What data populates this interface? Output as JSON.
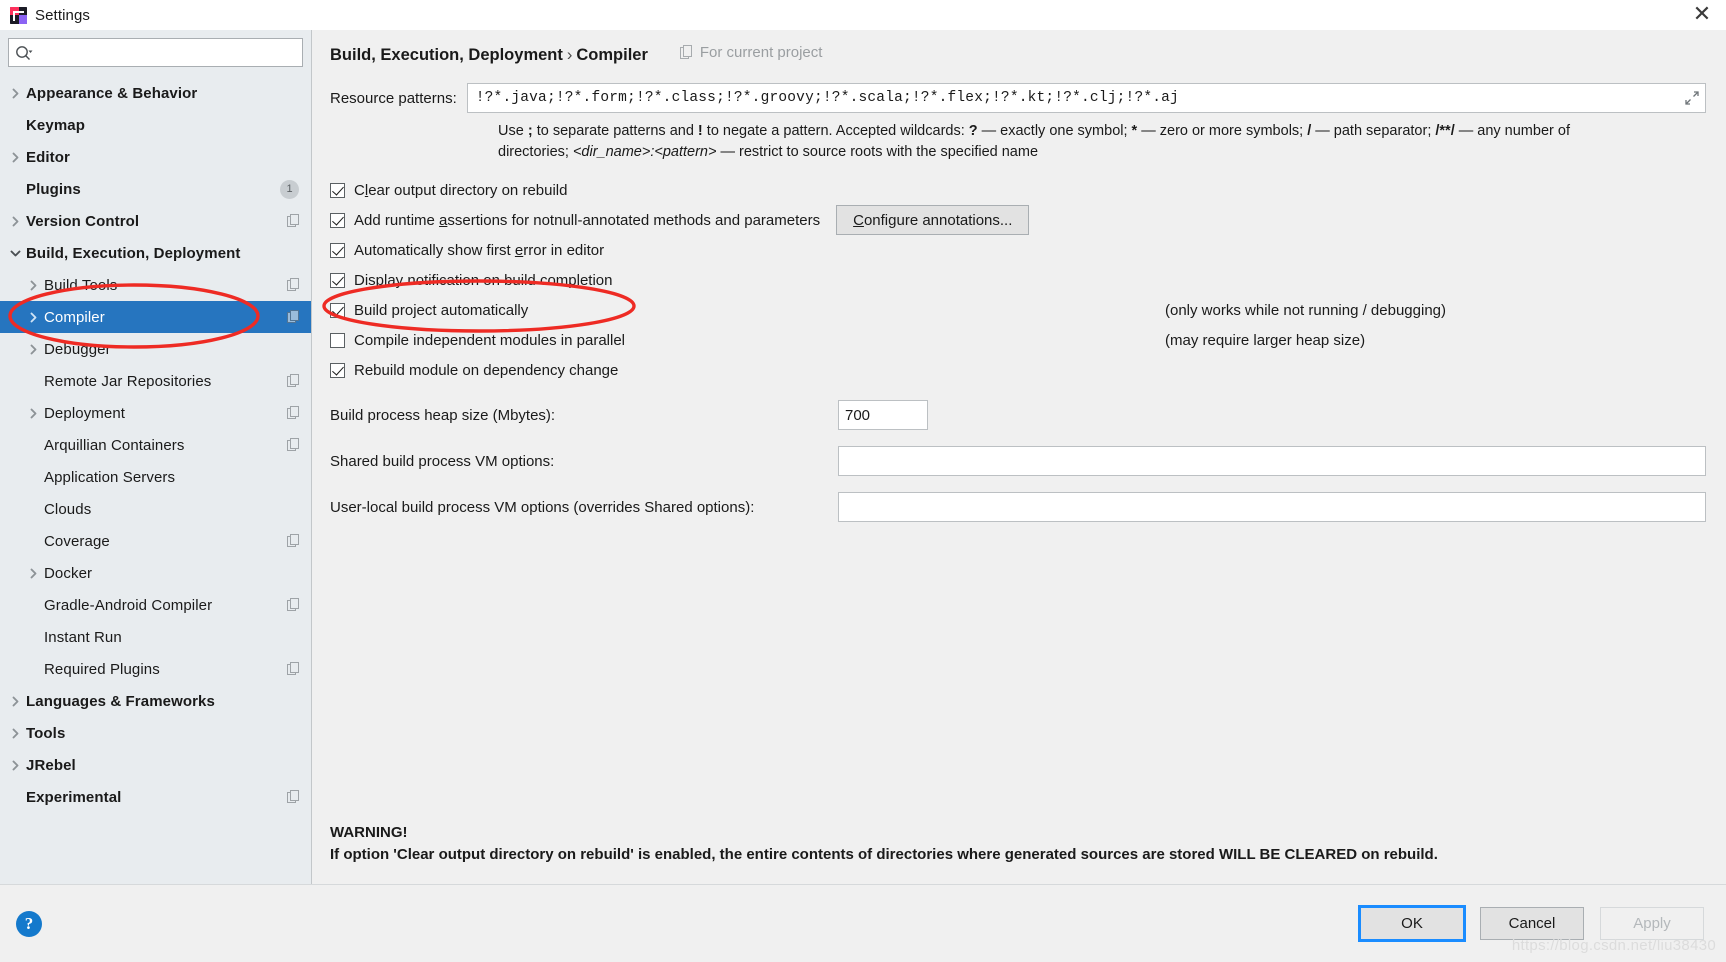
{
  "window": {
    "title": "Settings",
    "logo_icon": "intellij-idea-logo",
    "close_icon": "close-icon"
  },
  "search": {
    "value": "",
    "placeholder": "",
    "icon": "search-icon"
  },
  "sidebar": {
    "items": [
      {
        "label": "Appearance & Behavior",
        "depth": 0,
        "bold": true,
        "chevron": "chevron-right-icon",
        "badge": "",
        "copy": false
      },
      {
        "label": "Keymap",
        "depth": 0,
        "bold": true,
        "chevron": "",
        "badge": "",
        "copy": false
      },
      {
        "label": "Editor",
        "depth": 0,
        "bold": true,
        "chevron": "chevron-right-icon",
        "badge": "",
        "copy": false
      },
      {
        "label": "Plugins",
        "depth": 0,
        "bold": true,
        "chevron": "",
        "badge": "1",
        "copy": false
      },
      {
        "label": "Version Control",
        "depth": 0,
        "bold": true,
        "chevron": "chevron-right-icon",
        "badge": "",
        "copy": true
      },
      {
        "label": "Build, Execution, Deployment",
        "depth": 0,
        "bold": true,
        "chevron": "chevron-down-icon",
        "badge": "",
        "copy": false
      },
      {
        "label": "Build Tools",
        "depth": 1,
        "bold": false,
        "chevron": "chevron-right-icon",
        "badge": "",
        "copy": true
      },
      {
        "label": "Compiler",
        "depth": 1,
        "bold": false,
        "chevron": "chevron-right-icon",
        "badge": "",
        "copy": true,
        "selected": true
      },
      {
        "label": "Debugger",
        "depth": 1,
        "bold": false,
        "chevron": "chevron-right-icon",
        "badge": "",
        "copy": false
      },
      {
        "label": "Remote Jar Repositories",
        "depth": 1,
        "bold": false,
        "chevron": "",
        "badge": "",
        "copy": true
      },
      {
        "label": "Deployment",
        "depth": 1,
        "bold": false,
        "chevron": "chevron-right-icon",
        "badge": "",
        "copy": true
      },
      {
        "label": "Arquillian Containers",
        "depth": 1,
        "bold": false,
        "chevron": "",
        "badge": "",
        "copy": true
      },
      {
        "label": "Application Servers",
        "depth": 1,
        "bold": false,
        "chevron": "",
        "badge": "",
        "copy": false
      },
      {
        "label": "Clouds",
        "depth": 1,
        "bold": false,
        "chevron": "",
        "badge": "",
        "copy": false
      },
      {
        "label": "Coverage",
        "depth": 1,
        "bold": false,
        "chevron": "",
        "badge": "",
        "copy": true
      },
      {
        "label": "Docker",
        "depth": 1,
        "bold": false,
        "chevron": "chevron-right-icon",
        "badge": "",
        "copy": false
      },
      {
        "label": "Gradle-Android Compiler",
        "depth": 1,
        "bold": false,
        "chevron": "",
        "badge": "",
        "copy": true
      },
      {
        "label": "Instant Run",
        "depth": 1,
        "bold": false,
        "chevron": "",
        "badge": "",
        "copy": false
      },
      {
        "label": "Required Plugins",
        "depth": 1,
        "bold": false,
        "chevron": "",
        "badge": "",
        "copy": true
      },
      {
        "label": "Languages & Frameworks",
        "depth": 0,
        "bold": true,
        "chevron": "chevron-right-icon",
        "badge": "",
        "copy": false
      },
      {
        "label": "Tools",
        "depth": 0,
        "bold": true,
        "chevron": "chevron-right-icon",
        "badge": "",
        "copy": false
      },
      {
        "label": "JRebel",
        "depth": 0,
        "bold": true,
        "chevron": "chevron-right-icon",
        "badge": "",
        "copy": false
      },
      {
        "label": "Experimental",
        "depth": 0,
        "bold": true,
        "chevron": "",
        "badge": "",
        "copy": true
      }
    ]
  },
  "main": {
    "breadcrumb_parent": "Build, Execution, Deployment",
    "breadcrumb_sep": "›",
    "breadcrumb_current": "Compiler",
    "for_current_project": "For current project",
    "resource_patterns_label": "Resource patterns:",
    "resource_patterns_value": "!?*.java;!?*.form;!?*.class;!?*.groovy;!?*.scala;!?*.flex;!?*.kt;!?*.clj;!?*.aj",
    "expand_icon": "expand-diagonal-icon",
    "hint_line1_a": "Use ",
    "hint_semicolon": ";",
    "hint_line1_b": " to separate patterns and ",
    "hint_bang": "!",
    "hint_line1_c": " to negate a pattern. Accepted wildcards: ",
    "hint_q": "?",
    "hint_line1_d": " — exactly one symbol; ",
    "hint_star": "*",
    "hint_line1_e": " — zero or more symbols; ",
    "hint_slash": "/",
    "hint_line1_f": " — path separator; ",
    "hint_globstar": "/**/",
    "hint_line2_a": " — any number of directories; ",
    "hint_dirname": "<dir_name>:<pattern>",
    "hint_line2_b": " — restrict to source roots with the specified name",
    "checkboxes": [
      {
        "label_pre": "C",
        "mnemonic": "l",
        "label_post": "ear output directory on rebuild",
        "checked": true,
        "note": "",
        "name": "clear-output-directory-on-rebuild"
      },
      {
        "label_pre": "Add runtime ",
        "mnemonic": "a",
        "label_post": "ssertions for notnull-annotated methods and parameters",
        "checked": true,
        "note": "",
        "name": "add-runtime-assertions"
      },
      {
        "label_pre": "Automatically show first ",
        "mnemonic": "e",
        "label_post": "rror in editor",
        "checked": true,
        "note": "",
        "name": "automatically-show-first-error"
      },
      {
        "label_pre": "Display notification on build completion",
        "mnemonic": "",
        "label_post": "",
        "checked": true,
        "note": "",
        "name": "display-notification-on-build-completion"
      },
      {
        "label_pre": "Build project automatically",
        "mnemonic": "",
        "label_post": "",
        "checked": true,
        "note": "(only works while not running / debugging)",
        "name": "build-project-automatically"
      },
      {
        "label_pre": "Compile independent modules in parallel",
        "mnemonic": "",
        "label_post": "",
        "checked": false,
        "note": "(may require larger heap size)",
        "name": "compile-independent-modules-in-parallel"
      },
      {
        "label_pre": "Rebuild module on dependency change",
        "mnemonic": "",
        "label_post": "",
        "checked": true,
        "note": "",
        "name": "rebuild-module-on-dependency-change"
      }
    ],
    "configure_annotations_pre": "C",
    "configure_annotations_mnemonic": "C",
    "configure_annotations_label": "Configure annotations...",
    "heap_label": "Build process heap size (Mbytes):",
    "heap_value": "700",
    "shared_vm_label": "Shared build process VM options:",
    "shared_vm_value": "",
    "userlocal_vm_label": "User-local build process VM options (overrides Shared options):",
    "userlocal_vm_value": "",
    "warning_title": "WARNING!",
    "warning_body": "If option 'Clear output directory on rebuild' is enabled, the entire contents of directories where generated sources are stored WILL BE CLEARED on rebuild."
  },
  "footer": {
    "help_label": "?",
    "ok_label": "OK",
    "cancel_label": "Cancel",
    "apply_label": "Apply",
    "watermark": "https://blog.csdn.net/liu38430"
  },
  "colors": {
    "selection_blue": "#2675bf",
    "focus_blue": "#1a8cff",
    "help_blue": "#1479cc",
    "annotation_red": "#ee2b24",
    "sidebar_bg": "#e8ecef",
    "panel_bg": "#f0f0f0"
  },
  "annotations": [
    {
      "name": "red-ellipse-compiler",
      "shape": "ellipse"
    },
    {
      "name": "red-ellipse-build-project-automatically",
      "shape": "ellipse"
    }
  ]
}
